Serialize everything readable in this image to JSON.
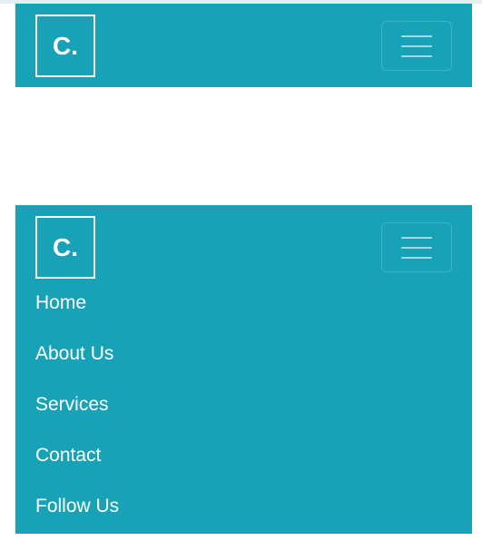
{
  "colors": {
    "navbar_bg": "#17a2b8",
    "text": "#ffffff"
  },
  "navbar_collapsed": {
    "brand": "C.",
    "toggler_icon": "hamburger-icon"
  },
  "navbar_expanded": {
    "brand": "C.",
    "toggler_icon": "hamburger-icon",
    "menu": [
      {
        "label": "Home"
      },
      {
        "label": "About Us"
      },
      {
        "label": "Services"
      },
      {
        "label": "Contact"
      },
      {
        "label": "Follow Us"
      }
    ]
  }
}
